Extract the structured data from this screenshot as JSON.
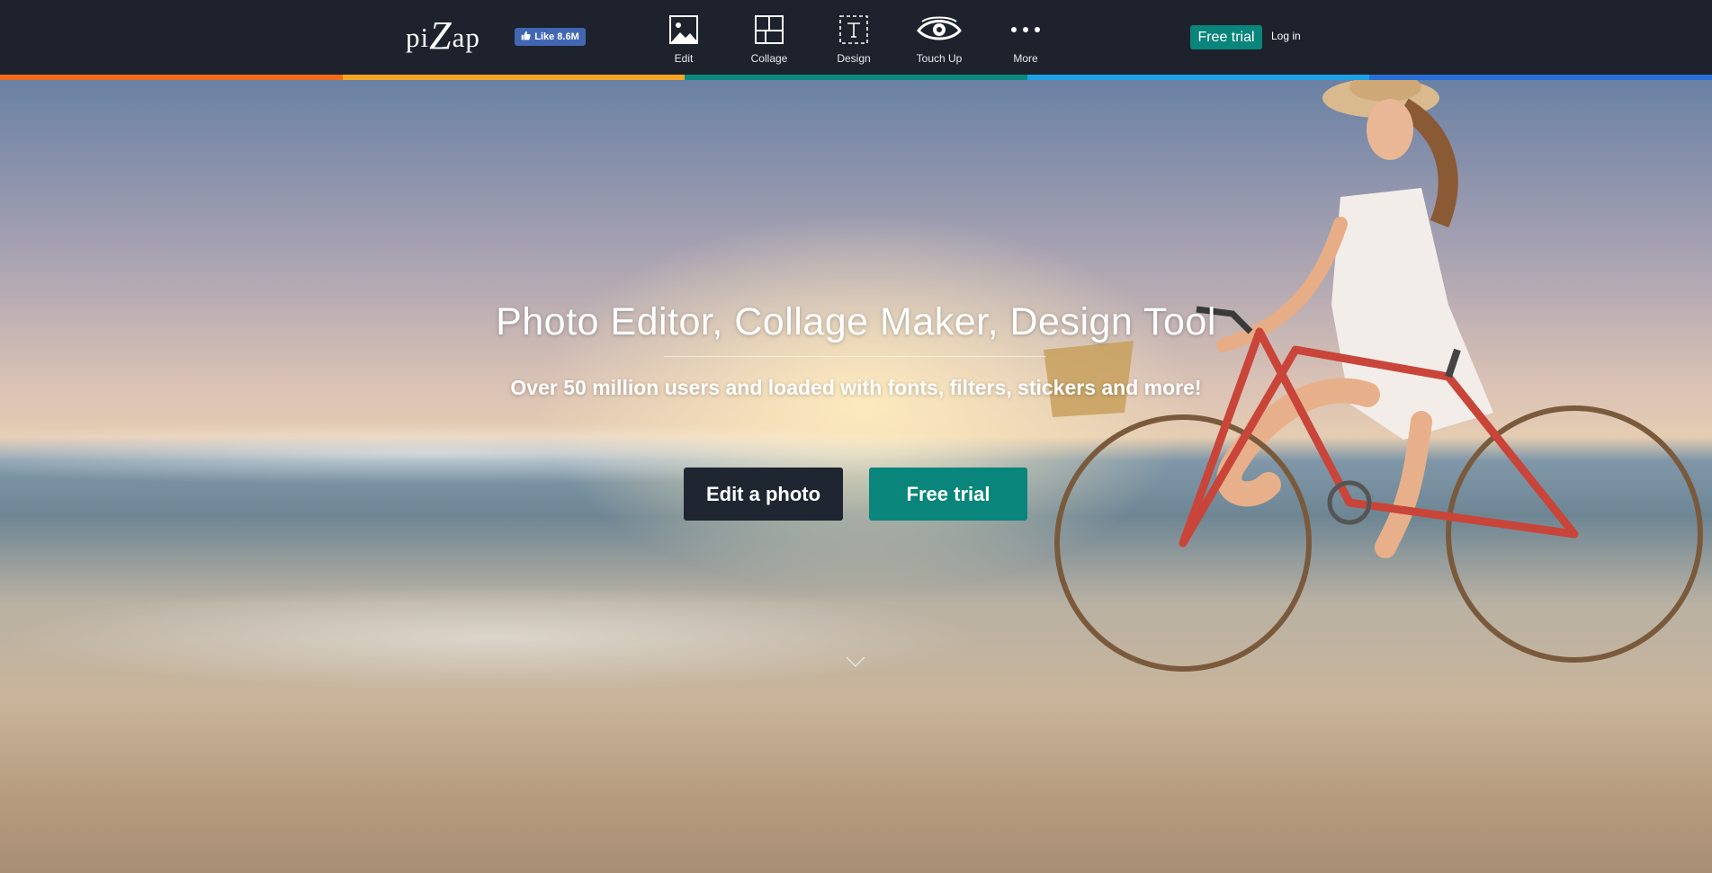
{
  "header": {
    "logo_text_a": "pi",
    "logo_text_b": "Z",
    "logo_text_c": "ap",
    "fb_like_label": "Like 8.6M",
    "nav": [
      {
        "label": "Edit",
        "icon": "image-icon"
      },
      {
        "label": "Collage",
        "icon": "collage-grid-icon"
      },
      {
        "label": "Design",
        "icon": "text-design-icon"
      },
      {
        "label": "Touch Up",
        "icon": "eye-icon"
      },
      {
        "label": "More",
        "icon": "more-dots-icon"
      }
    ],
    "free_trial_label": "Free trial",
    "login_label": "Log in"
  },
  "strip_colors": [
    "#f26a1b",
    "#f5a623",
    "#0a8a7e",
    "#1ea2e6",
    "#2a6fd6"
  ],
  "hero": {
    "title": "Photo Editor, Collage Maker, Design Tool",
    "subtitle": "Over 50 million users and loaded with fonts, filters, stickers and more!",
    "edit_button_label": "Edit a photo",
    "trial_button_label": "Free trial"
  },
  "colors": {
    "header_bg": "#1d222c",
    "accent_green": "#09857b",
    "dark_button": "#1f2632",
    "facebook_blue": "#4267b2"
  }
}
